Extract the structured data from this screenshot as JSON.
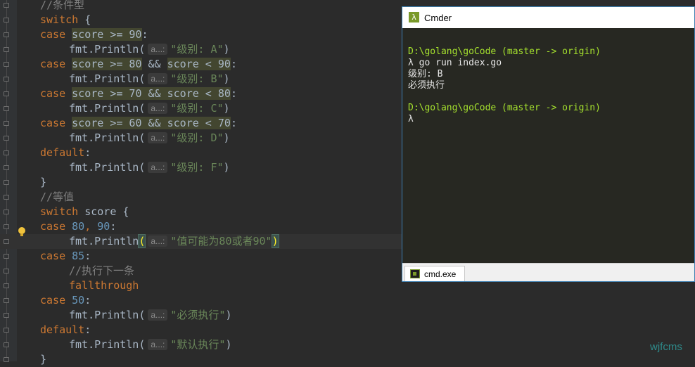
{
  "editor": {
    "lines": [
      {
        "indent": 0,
        "parts": [
          {
            "t": "//条件型",
            "c": "cmt"
          }
        ]
      },
      {
        "indent": 0,
        "parts": [
          {
            "t": "switch",
            "c": "kw"
          },
          {
            "t": " {",
            "c": "plain"
          }
        ]
      },
      {
        "indent": 0,
        "parts": [
          {
            "t": "case ",
            "c": "kw"
          },
          {
            "t": "score >= 90",
            "c": "plain hl",
            "num_part": true
          },
          {
            "t": ":",
            "c": "plain"
          }
        ]
      },
      {
        "indent": 1,
        "parts": [
          {
            "t": "fmt.Println(",
            "c": "plain"
          },
          {
            "t": "a...:",
            "c": "hint"
          },
          {
            "t": "\"级别: A\"",
            "c": "str"
          },
          {
            "t": ")",
            "c": "plain"
          }
        ]
      },
      {
        "indent": 0,
        "parts": [
          {
            "t": "case ",
            "c": "kw"
          },
          {
            "t": "score >= 80",
            "c": "plain hl"
          },
          {
            "t": " && ",
            "c": "plain"
          },
          {
            "t": "score < 90",
            "c": "plain hl"
          },
          {
            "t": ":",
            "c": "plain"
          }
        ]
      },
      {
        "indent": 1,
        "parts": [
          {
            "t": "fmt.Println(",
            "c": "plain"
          },
          {
            "t": "a...:",
            "c": "hint"
          },
          {
            "t": "\"级别: B\"",
            "c": "str"
          },
          {
            "t": ")",
            "c": "plain"
          }
        ]
      },
      {
        "indent": 0,
        "parts": [
          {
            "t": "case ",
            "c": "kw"
          },
          {
            "t": "score >= 70 && score < 80",
            "c": "plain hl"
          },
          {
            "t": ":",
            "c": "plain"
          }
        ]
      },
      {
        "indent": 1,
        "parts": [
          {
            "t": "fmt.Println(",
            "c": "plain"
          },
          {
            "t": "a...:",
            "c": "hint"
          },
          {
            "t": "\"级别: C\"",
            "c": "str"
          },
          {
            "t": ")",
            "c": "plain"
          }
        ]
      },
      {
        "indent": 0,
        "parts": [
          {
            "t": "case ",
            "c": "kw"
          },
          {
            "t": "score >= 60 && score < 70",
            "c": "plain hl"
          },
          {
            "t": ":",
            "c": "plain"
          }
        ]
      },
      {
        "indent": 1,
        "parts": [
          {
            "t": "fmt.Println(",
            "c": "plain"
          },
          {
            "t": "a...:",
            "c": "hint"
          },
          {
            "t": "\"级别: D\"",
            "c": "str"
          },
          {
            "t": ")",
            "c": "plain"
          }
        ]
      },
      {
        "indent": 0,
        "parts": [
          {
            "t": "default",
            "c": "kw"
          },
          {
            "t": ":",
            "c": "plain"
          }
        ]
      },
      {
        "indent": 1,
        "parts": [
          {
            "t": "fmt.Println(",
            "c": "plain"
          },
          {
            "t": "a...:",
            "c": "hint"
          },
          {
            "t": "\"级别: F\"",
            "c": "str"
          },
          {
            "t": ")",
            "c": "plain"
          }
        ]
      },
      {
        "indent": 0,
        "parts": [
          {
            "t": "}",
            "c": "plain"
          }
        ]
      },
      {
        "indent": 0,
        "parts": [
          {
            "t": "//等值",
            "c": "cmt"
          }
        ]
      },
      {
        "indent": 0,
        "parts": [
          {
            "t": "switch",
            "c": "kw"
          },
          {
            "t": " score {",
            "c": "plain"
          }
        ]
      },
      {
        "indent": 0,
        "parts": [
          {
            "t": "case ",
            "c": "kw"
          },
          {
            "t": "80",
            "c": "num"
          },
          {
            "t": ", ",
            "c": "kw"
          },
          {
            "t": "90",
            "c": "num"
          },
          {
            "t": ":",
            "c": "plain"
          }
        ]
      },
      {
        "indent": 1,
        "active": true,
        "parts": [
          {
            "t": "fmt.Println",
            "c": "plain"
          },
          {
            "t": "(",
            "c": "plain bracket"
          },
          {
            "t": "a...:",
            "c": "hint"
          },
          {
            "t": "\"值可能为80或者90\"",
            "c": "str"
          },
          {
            "t": ")",
            "c": "plain bracket"
          }
        ]
      },
      {
        "indent": 0,
        "parts": [
          {
            "t": "case ",
            "c": "kw"
          },
          {
            "t": "85",
            "c": "num"
          },
          {
            "t": ":",
            "c": "plain"
          }
        ]
      },
      {
        "indent": 1,
        "parts": [
          {
            "t": "//执行下一条",
            "c": "cmt"
          }
        ]
      },
      {
        "indent": 1,
        "parts": [
          {
            "t": "fallthrough",
            "c": "kw"
          }
        ]
      },
      {
        "indent": 0,
        "parts": [
          {
            "t": "case ",
            "c": "kw"
          },
          {
            "t": "50",
            "c": "num"
          },
          {
            "t": ":",
            "c": "plain"
          }
        ]
      },
      {
        "indent": 1,
        "parts": [
          {
            "t": "fmt.Println(",
            "c": "plain"
          },
          {
            "t": "a...:",
            "c": "hint"
          },
          {
            "t": "\"必须执行\"",
            "c": "str"
          },
          {
            "t": ")",
            "c": "plain"
          }
        ]
      },
      {
        "indent": 0,
        "parts": [
          {
            "t": "default",
            "c": "kw"
          },
          {
            "t": ":",
            "c": "plain"
          }
        ]
      },
      {
        "indent": 1,
        "parts": [
          {
            "t": "fmt.Println(",
            "c": "plain"
          },
          {
            "t": "a...:",
            "c": "hint"
          },
          {
            "t": "\"默认执行\"",
            "c": "str"
          },
          {
            "t": ")",
            "c": "plain"
          }
        ]
      },
      {
        "indent": 0,
        "parts": [
          {
            "t": "}",
            "c": "plain"
          }
        ]
      }
    ]
  },
  "cmder": {
    "title": "Cmder",
    "app_icon_glyph": "λ",
    "console_lines": [
      {
        "t": "",
        "c": ""
      },
      {
        "t": "D:\\golang\\goCode (master -> origin)",
        "c": "path"
      },
      {
        "t": "λ go run index.go",
        "c": ""
      },
      {
        "t": "级别: B",
        "c": ""
      },
      {
        "t": "必须执行",
        "c": ""
      },
      {
        "t": "",
        "c": ""
      },
      {
        "t": "D:\\golang\\goCode (master -> origin)",
        "c": "path"
      },
      {
        "t": "λ",
        "c": ""
      }
    ],
    "tab_label": "cmd.exe"
  },
  "watermark": "wjfcms",
  "colors": {
    "editor_bg": "#2b2b2b",
    "keyword": "#cc7832",
    "number": "#6897bb",
    "string": "#6a8759",
    "comment": "#808080",
    "console_bg": "#272822",
    "console_path": "#a6e22e"
  }
}
